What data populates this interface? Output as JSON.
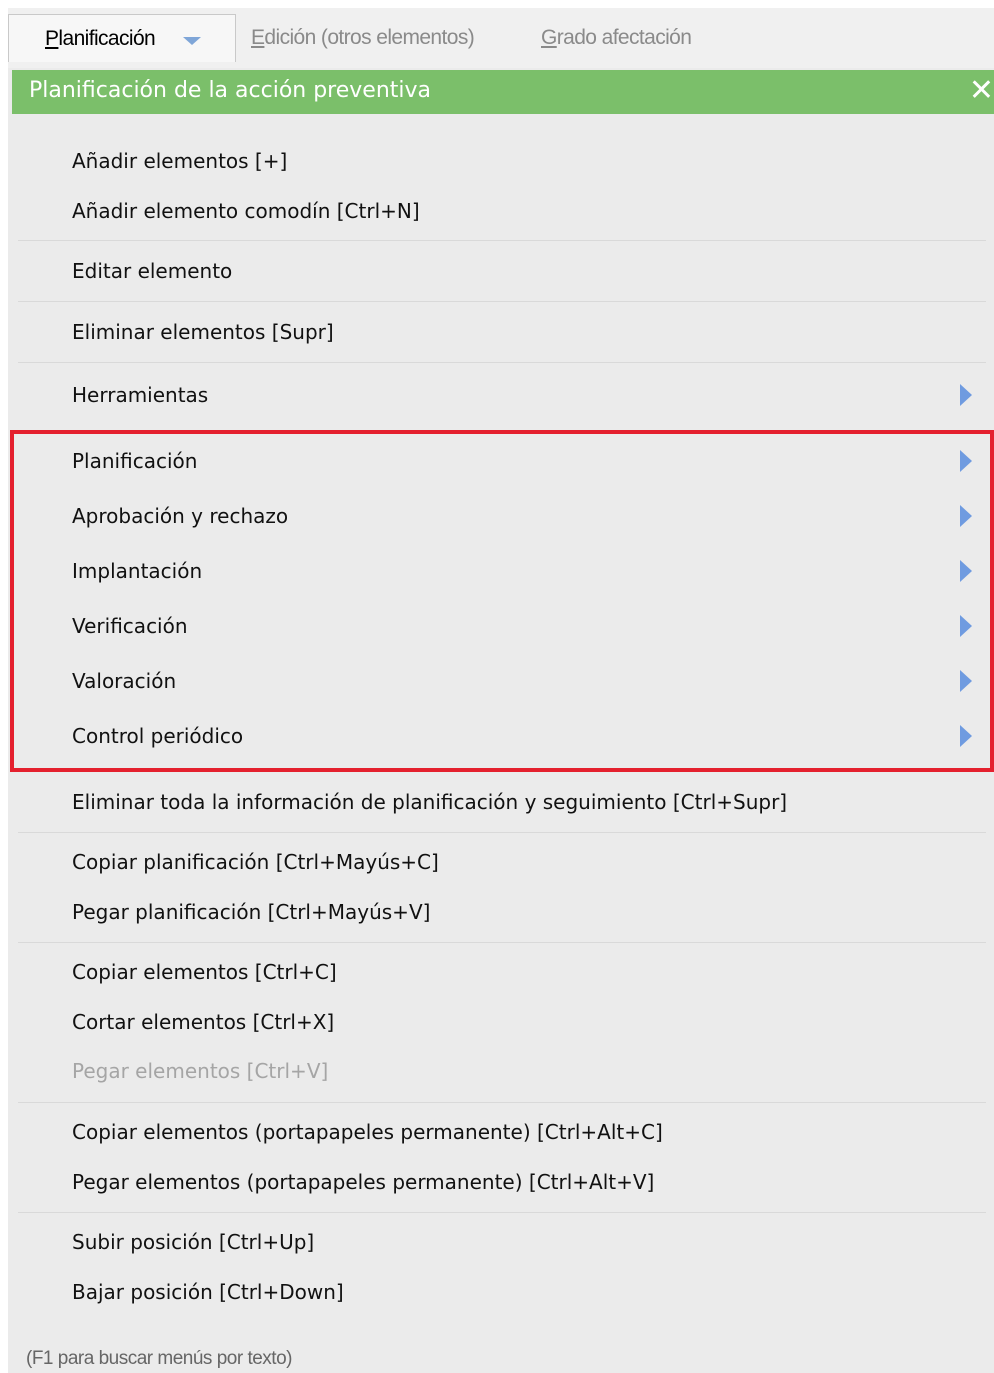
{
  "tabs": {
    "active": {
      "mnemonic": "P",
      "rest": "lanificación"
    },
    "disabled": [
      {
        "mnemonic": "E",
        "rest": "dición (otros elementos)"
      },
      {
        "mnemonic": "G",
        "rest": "rado afectación"
      }
    ]
  },
  "panel": {
    "title": "Planificación de la acción preventiva",
    "close": "✕"
  },
  "menu": {
    "items": [
      {
        "label": "Añadir elementos  [+]",
        "enabled": true,
        "submenu": false
      },
      {
        "label": "Añadir elemento comodín  [Ctrl+N]",
        "enabled": true,
        "submenu": false
      },
      {
        "label": "Editar elemento",
        "enabled": true,
        "submenu": false
      },
      {
        "label": "Eliminar elementos  [Supr]",
        "enabled": true,
        "submenu": false
      },
      {
        "label": "Herramientas",
        "enabled": true,
        "submenu": true
      },
      {
        "label": "Planificación",
        "enabled": true,
        "submenu": true
      },
      {
        "label": "Aprobación y rechazo",
        "enabled": true,
        "submenu": true
      },
      {
        "label": "Implantación",
        "enabled": true,
        "submenu": true
      },
      {
        "label": "Verificación",
        "enabled": true,
        "submenu": true
      },
      {
        "label": "Valoración",
        "enabled": true,
        "submenu": true
      },
      {
        "label": "Control periódico",
        "enabled": true,
        "submenu": true
      },
      {
        "label": "Eliminar toda la información de planificación y seguimiento  [Ctrl+Supr]",
        "enabled": true,
        "submenu": false
      },
      {
        "label": "Copiar planificación  [Ctrl+Mayús+C]",
        "enabled": true,
        "submenu": false
      },
      {
        "label": "Pegar planificación  [Ctrl+Mayús+V]",
        "enabled": true,
        "submenu": false
      },
      {
        "label": "Copiar elementos  [Ctrl+C]",
        "enabled": true,
        "submenu": false
      },
      {
        "label": "Cortar elementos  [Ctrl+X]",
        "enabled": true,
        "submenu": false
      },
      {
        "label": "Pegar elementos  [Ctrl+V]",
        "enabled": false,
        "submenu": false
      },
      {
        "label": "Copiar elementos (portapapeles permanente)  [Ctrl+Alt+C]",
        "enabled": true,
        "submenu": false
      },
      {
        "label": "Pegar elementos (portapapeles permanente)  [Ctrl+Alt+V]",
        "enabled": true,
        "submenu": false
      },
      {
        "label": "Subir posición  [Ctrl+Up]",
        "enabled": true,
        "submenu": false
      },
      {
        "label": "Bajar posición  [Ctrl+Down]",
        "enabled": true,
        "submenu": false
      }
    ]
  },
  "hint": "(F1 para buscar menús por texto)",
  "colors": {
    "header": "#7bbf6a",
    "highlight_border": "#e4202e",
    "submenu_arrow": "#6f9be0"
  }
}
